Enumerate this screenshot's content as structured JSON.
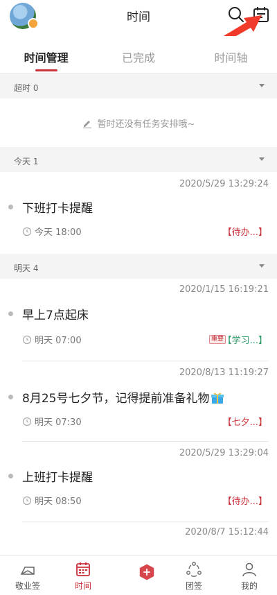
{
  "header": {
    "title": "时间",
    "icons": [
      "avatar",
      "search-icon",
      "calendar-icon"
    ],
    "accent_color": "#c9303a"
  },
  "tabs": [
    {
      "label": "时间管理",
      "active": true
    },
    {
      "label": "已完成",
      "active": false
    },
    {
      "label": "时间轴",
      "active": false
    }
  ],
  "sections": {
    "overdue": {
      "label": "超时 0",
      "empty_message": "暂时还没有任务安排哦~"
    },
    "today": {
      "label": "今天 1"
    },
    "tomorrow": {
      "label": "明天 4"
    }
  },
  "items": [
    {
      "timestamp": "2020/5/29 13:29:24",
      "title": "下班打卡提醒",
      "time": "今天 18:00",
      "tag": "【待办...】",
      "tag_color": "#c9303a"
    },
    {
      "timestamp": "2020/1/15 16:19:21",
      "title": "早上7点起床",
      "time": "明天 07:00",
      "badge": "重要",
      "tag": "【学习...】",
      "tag_color": "#2f9a68"
    },
    {
      "timestamp": "2020/8/13 11:19:27",
      "title": "8月25号七夕节，记得提前准备礼物",
      "time": "明天 07:30",
      "tag": "【七夕...】",
      "tag_color": "#c9303a"
    },
    {
      "timestamp": "2020/5/29 13:29:04",
      "title": "上班打卡提醒",
      "time": "明天 08:50",
      "tag": "【待办...】",
      "tag_color": "#c9303a"
    },
    {
      "timestamp": "2020/8/7 15:12:44"
    }
  ],
  "bottom_nav": [
    {
      "label": "敬业签",
      "icon": "envelope-icon",
      "active": false
    },
    {
      "label": "时间",
      "icon": "calendar-grid-icon",
      "active": true
    },
    {
      "label": "",
      "icon": "add-icon",
      "active": false
    },
    {
      "label": "团签",
      "icon": "team-icon",
      "active": false
    },
    {
      "label": "我的",
      "icon": "user-icon",
      "active": false
    }
  ]
}
